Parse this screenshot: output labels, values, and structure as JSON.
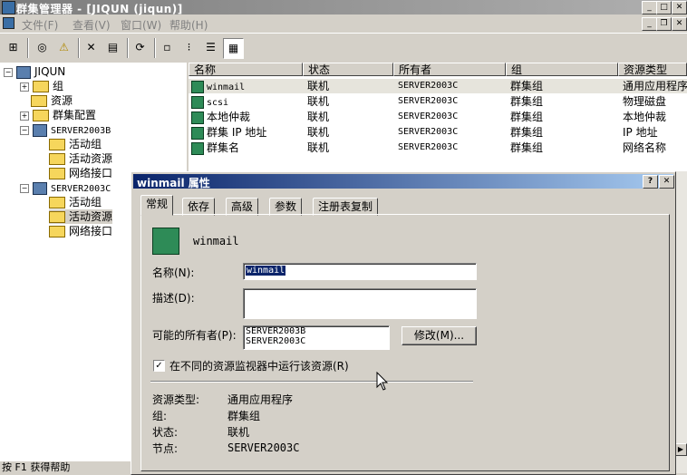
{
  "window": {
    "title": "群集管理器 - [JIQUN (jiqun)]"
  },
  "menu": [
    "文件(F)",
    "查看(V)",
    "窗口(W)",
    "帮助(H)"
  ],
  "tree": {
    "root": "JIQUN",
    "nodes": [
      {
        "label": "组",
        "level": 1,
        "expander": "+"
      },
      {
        "label": "资源",
        "level": 1,
        "expander": ""
      },
      {
        "label": "群集配置",
        "level": 1,
        "expander": "+"
      },
      {
        "label": "SERVER2003B",
        "level": 1,
        "expander": "−",
        "type": "server"
      },
      {
        "label": "活动组",
        "level": 2,
        "expander": ""
      },
      {
        "label": "活动资源",
        "level": 2,
        "expander": ""
      },
      {
        "label": "网络接口",
        "level": 2,
        "expander": ""
      },
      {
        "label": "SERVER2003C",
        "level": 1,
        "expander": "−",
        "type": "server"
      },
      {
        "label": "活动组",
        "level": 2,
        "expander": ""
      },
      {
        "label": "活动资源",
        "level": 2,
        "expander": "",
        "selected": true
      },
      {
        "label": "网络接口",
        "level": 2,
        "expander": ""
      }
    ]
  },
  "list": {
    "columns": [
      "名称",
      "状态",
      "所有者",
      "组",
      "资源类型"
    ],
    "rows": [
      [
        "winmail",
        "联机",
        "SERVER2003C",
        "群集组",
        "通用应用程序"
      ],
      [
        "scsi",
        "联机",
        "SERVER2003C",
        "群集组",
        "物理磁盘"
      ],
      [
        "本地仲裁",
        "联机",
        "SERVER2003C",
        "群集组",
        "本地仲裁"
      ],
      [
        "群集 IP 地址",
        "联机",
        "SERVER2003C",
        "群集组",
        "IP 地址"
      ],
      [
        "群集名",
        "联机",
        "SERVER2003C",
        "群集组",
        "网络名称"
      ]
    ]
  },
  "dialog": {
    "title": "winmail 属性",
    "tabs": [
      "常规",
      "依存",
      "高级",
      "参数",
      "注册表复制"
    ],
    "resource_name": "winmail",
    "name_label": "名称(N):",
    "name_value": "winmail",
    "desc_label": "描述(D):",
    "desc_value": "",
    "owners_label": "可能的所有者(P):",
    "owners": [
      "SERVER2003B",
      "SERVER2003C"
    ],
    "modify_button": "修改(M)...",
    "checkbox_label": "在不同的资源监视器中运行该资源(R)",
    "checkbox_checked": true,
    "info": {
      "type_label": "资源类型:",
      "type_value": "通用应用程序",
      "group_label": "组:",
      "group_value": "群集组",
      "state_label": "状态:",
      "state_value": "联机",
      "node_label": "节点:",
      "node_value": "SERVER2003C"
    }
  },
  "status": "按 F1 获得帮助"
}
